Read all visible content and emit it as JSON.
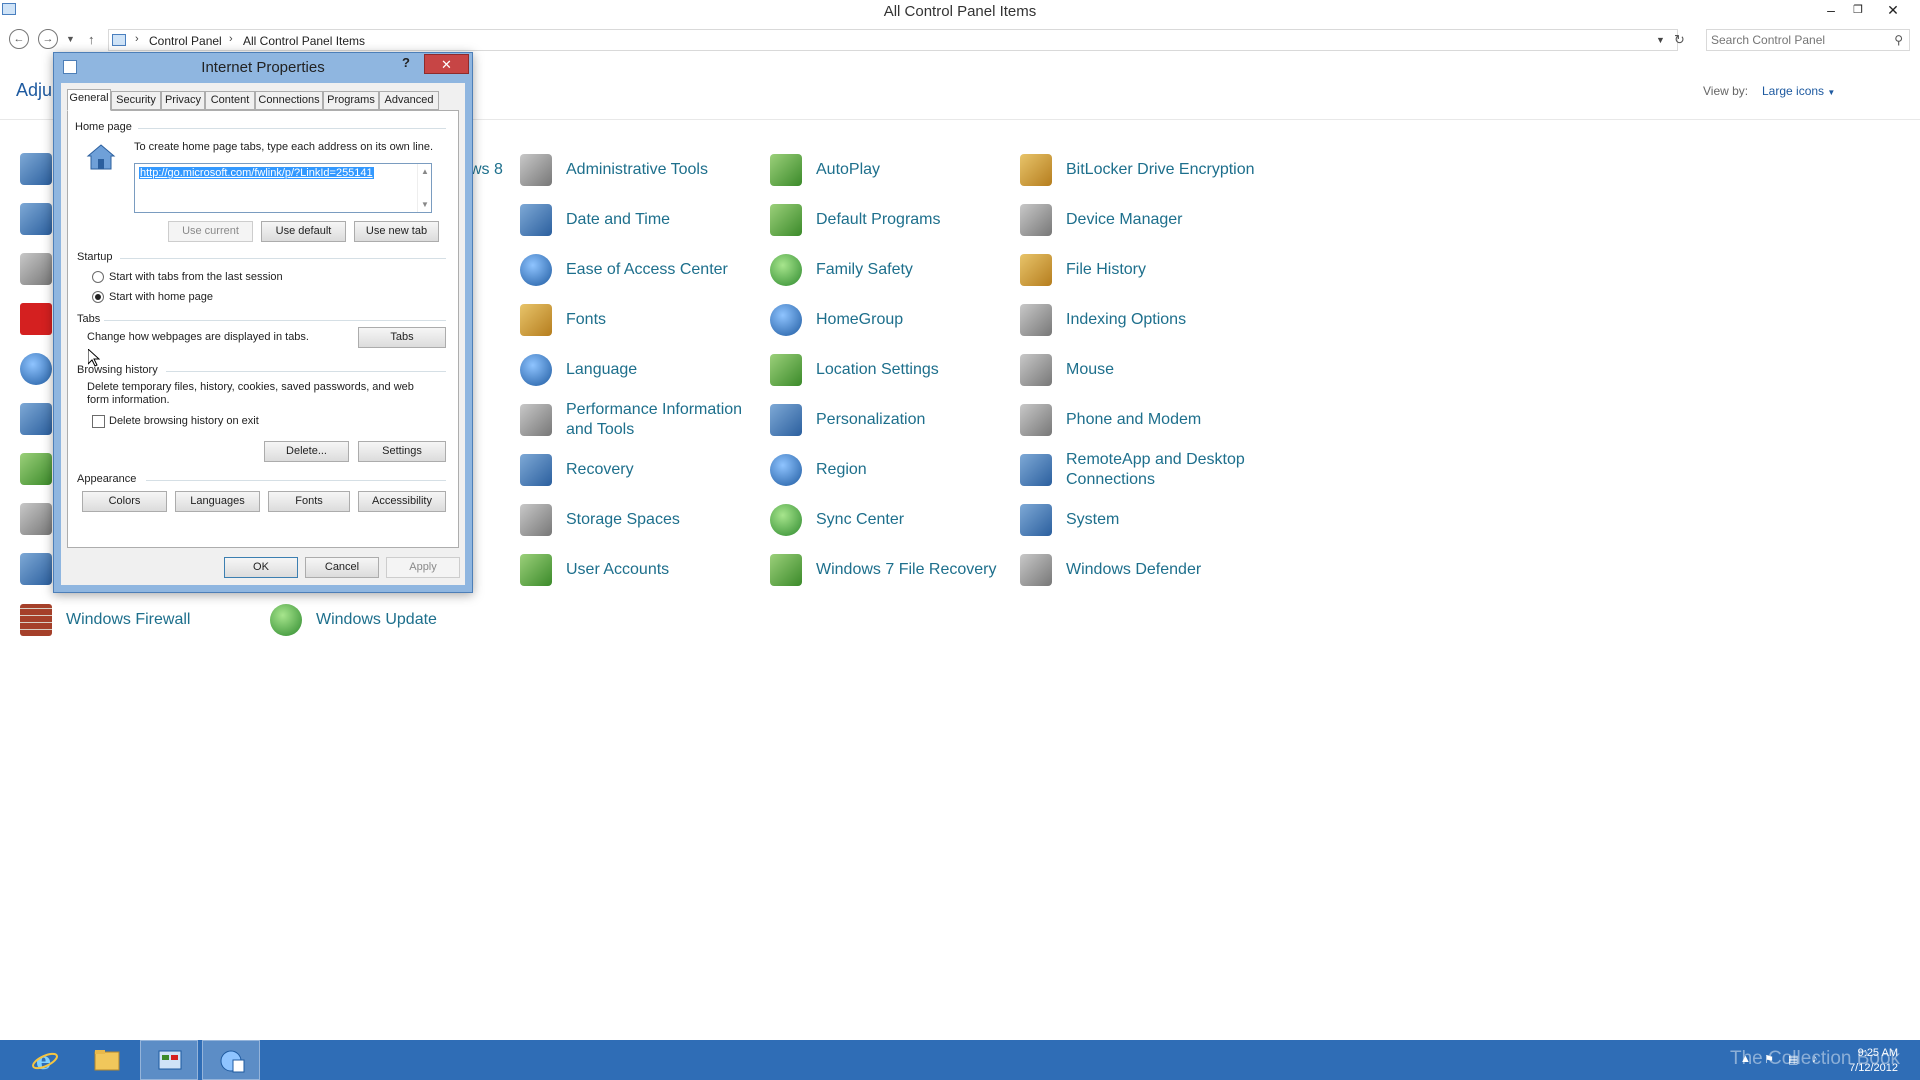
{
  "window": {
    "title": "All Control Panel Items",
    "breadcrumb": [
      "Control Panel",
      "All Control Panel Items"
    ],
    "search_placeholder": "Search Control Panel",
    "heading": "Adju",
    "view_by_label": "View by:",
    "view_by_value": "Large icons"
  },
  "items": [
    {
      "label": "ws 8",
      "icon": "windows-icon"
    },
    {
      "label": "Administrative Tools",
      "icon": "admin-tools-icon"
    },
    {
      "label": "AutoPlay",
      "icon": "autoplay-icon"
    },
    {
      "label": "BitLocker Drive Encryption",
      "icon": "bitlocker-icon"
    },
    {
      "label": "Date and Time",
      "icon": "calendar-icon"
    },
    {
      "label": "Default Programs",
      "icon": "default-programs-icon"
    },
    {
      "label": "Device Manager",
      "icon": "device-manager-icon"
    },
    {
      "label": "Ease of Access Center",
      "icon": "ease-of-access-icon"
    },
    {
      "label": "Family Safety",
      "icon": "family-safety-icon"
    },
    {
      "label": "File History",
      "icon": "file-history-icon"
    },
    {
      "label": "Fonts",
      "icon": "fonts-folder-icon"
    },
    {
      "label": "HomeGroup",
      "icon": "homegroup-icon"
    },
    {
      "label": "Indexing Options",
      "icon": "indexing-icon"
    },
    {
      "label": "Language",
      "icon": "language-icon"
    },
    {
      "label": "Location Settings",
      "icon": "location-icon"
    },
    {
      "label": "Mouse",
      "icon": "mouse-icon"
    },
    {
      "label": "Performance Information and Tools",
      "label_line1": "Performance Information",
      "label_line2": "and Tools",
      "icon": "performance-icon"
    },
    {
      "label": "Personalization",
      "icon": "personalization-icon"
    },
    {
      "label": "Phone and Modem",
      "icon": "phone-modem-icon"
    },
    {
      "label": "Recovery",
      "icon": "recovery-icon"
    },
    {
      "label": "Region",
      "icon": "region-icon"
    },
    {
      "label": "RemoteApp and Desktop Connections",
      "label_line1": "RemoteApp and Desktop",
      "label_line2": "Connections",
      "icon": "remoteapp-icon"
    },
    {
      "label": "Storage Spaces",
      "icon": "storage-spaces-icon"
    },
    {
      "label": "Sync Center",
      "icon": "sync-center-icon"
    },
    {
      "label": "System",
      "icon": "system-icon"
    },
    {
      "label": "User Accounts",
      "icon": "user-accounts-icon"
    },
    {
      "label": "Windows 7 File Recovery",
      "icon": "file-recovery-icon"
    },
    {
      "label": "Windows Defender",
      "icon": "defender-icon"
    },
    {
      "label": "Windows Firewall",
      "icon": "firewall-icon"
    },
    {
      "label": "Windows Update",
      "icon": "windows-update-icon"
    }
  ],
  "dialog": {
    "title": "Internet Properties",
    "help": "?",
    "close": "✕",
    "tabs": [
      "General",
      "Security",
      "Privacy",
      "Content",
      "Connections",
      "Programs",
      "Advanced"
    ],
    "active_tab": "General",
    "home_page": {
      "group_label": "Home page",
      "instruction": "To create home page tabs, type each address on its own line.",
      "url": "http://go.microsoft.com/fwlink/p/?LinkId=255141",
      "use_current": "Use current",
      "use_default": "Use default",
      "use_new_tab": "Use new tab"
    },
    "startup": {
      "group_label": "Startup",
      "option1": "Start with tabs from the last session",
      "option2": "Start with home page",
      "selected": "Start with home page"
    },
    "tabs_group": {
      "group_label": "Tabs",
      "description": "Change how webpages are displayed in tabs.",
      "button": "Tabs"
    },
    "browsing_history": {
      "group_label": "Browsing history",
      "description_line1": "Delete temporary files, history, cookies, saved passwords, and web",
      "description_line2": "form information.",
      "checkbox_label": "Delete browsing history on exit",
      "checked": false,
      "delete_button": "Delete...",
      "settings_button": "Settings"
    },
    "appearance": {
      "group_label": "Appearance",
      "colors": "Colors",
      "languages": "Languages",
      "fonts": "Fonts",
      "accessibility": "Accessibility"
    },
    "ok": "OK",
    "cancel": "Cancel",
    "apply": "Apply"
  },
  "taskbar": {
    "time": "9:25 AM",
    "date": "7/12/2012",
    "watermark": "The Collection Book",
    "accent": "#2f6db6"
  }
}
